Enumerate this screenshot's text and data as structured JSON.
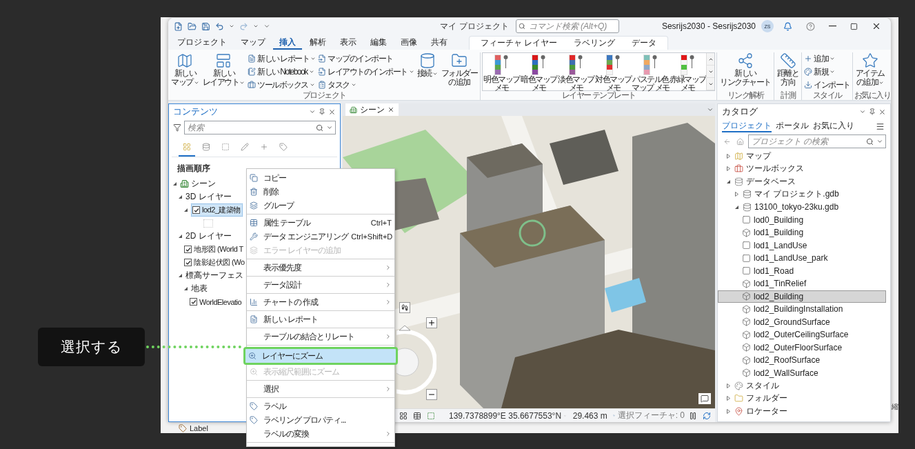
{
  "callout": {
    "text": "選択する"
  },
  "background_window": {
    "bottom_label": "Label",
    "edge_text": "縮"
  },
  "title_bar": {
    "project": "マイ プロジェクト",
    "search": {
      "placeholder": "コマンド検索 (Alt+Q)"
    },
    "user": "Sesrijs2030 - Sesrijs2030",
    "avatar": "ZS"
  },
  "ribbon_tabs": [
    {
      "label": "プロジェクト",
      "selected": false
    },
    {
      "label": "マップ",
      "selected": false
    },
    {
      "label": "挿入",
      "selected": true
    },
    {
      "label": "解析",
      "selected": false
    },
    {
      "label": "表示",
      "selected": false
    },
    {
      "label": "編集",
      "selected": false
    },
    {
      "label": "画像",
      "selected": false
    },
    {
      "label": "共有",
      "selected": false
    }
  ],
  "contextual_tabs": [
    {
      "label": "フィーチャ レイヤー"
    },
    {
      "label": "ラベリング"
    },
    {
      "label": "データ"
    }
  ],
  "ribbon_groups": [
    {
      "title": "プロジェクト",
      "controls": [
        {
          "kind": "large",
          "lines": [
            "新しい",
            "マップ"
          ],
          "dropdown": true
        },
        {
          "kind": "large",
          "lines": [
            "新しい",
            "レイアウト"
          ],
          "dropdown": true
        },
        {
          "kind": "stack",
          "items": [
            {
              "label": "新しい レポート",
              "dropdown": true
            },
            {
              "label": "新しい Notebook",
              "dropdown": true
            },
            {
              "label": "ツールボックス",
              "dropdown": true
            }
          ]
        },
        {
          "kind": "stack",
          "items": [
            {
              "label": "マップのインポート",
              "dropdown": false
            },
            {
              "label": "レイアウトのインポート",
              "dropdown": true
            },
            {
              "label": "タスク",
              "dropdown": true
            }
          ]
        },
        {
          "kind": "large",
          "lines": [
            "接続"
          ],
          "dropdown": true
        },
        {
          "kind": "large",
          "lines": [
            "フォルダー",
            "の追加"
          ],
          "dropdown": false
        }
      ]
    },
    {
      "title": "レイヤー テンプレート",
      "controls": [
        {
          "kind": "gallery",
          "items": [
            {
              "lines": [
                "明色マップ",
                "メモ"
              ],
              "swatch": [
                {
                  "color": "#e06060"
                },
                {
                  "color": "#3c9ad6"
                },
                {
                  "color": "#5aa84a"
                },
                {
                  "color": "#9a6cb0"
                }
              ]
            },
            {
              "lines": [
                "暗色マップ",
                "メモ"
              ],
              "swatch": [
                {
                  "color": "#d81818"
                },
                {
                  "color": "#2e6fc0"
                },
                {
                  "color": "#3a8a2a"
                },
                {
                  "color": "#8a4aa0"
                }
              ]
            },
            {
              "lines": [
                "淡色マップ",
                "メモ"
              ],
              "swatch": [
                {
                  "color": "#e02828"
                },
                {
                  "color": "#3d6fb0"
                },
                {
                  "color": "#4a9a3a"
                },
                {
                  "color": "#9a5a9a"
                }
              ]
            },
            {
              "lines": [
                "対色マップ",
                "メモ"
              ],
              "swatch": [
                {
                  "color": "#3c78c0"
                },
                {
                  "color": "#6aa84f"
                },
                {
                  "color": "#e03030"
                },
                {
                  "color": "#f4f4f4"
                }
              ]
            },
            {
              "lines": [
                "パステル色",
                "マップ メモ"
              ],
              "swatch": [
                {
                  "color": "#7fc0b8"
                },
                {
                  "color": "#f0a860"
                },
                {
                  "color": "#8fa8c8"
                },
                {
                  "color": "#e89ab0"
                }
              ]
            },
            {
              "lines": [
                "赤緑マップ",
                "メモ"
              ],
              "swatch": [
                {
                  "color": "#e01818"
                },
                {
                  "color": "#f4f4f4"
                },
                {
                  "color": "#50c040"
                },
                {
                  "color": "#f4f4f4"
                }
              ]
            }
          ]
        }
      ]
    },
    {
      "title": "リンク解析",
      "controls": [
        {
          "kind": "large",
          "lines": [
            "新しい",
            "リンクチャート"
          ],
          "dropdown": false
        }
      ]
    },
    {
      "title": "計測",
      "controls": [
        {
          "kind": "large",
          "lines": [
            "距離と",
            "方向"
          ],
          "dropdown": false
        }
      ]
    },
    {
      "title": "スタイル",
      "controls": [
        {
          "kind": "stack",
          "items": [
            {
              "label": "追加",
              "dropdown": true
            },
            {
              "label": "新規",
              "dropdown": true
            },
            {
              "label": "インポート",
              "dropdown": false
            }
          ]
        }
      ]
    },
    {
      "title": "お気に入り",
      "controls": [
        {
          "kind": "large",
          "lines": [
            "アイテム",
            "の追加"
          ],
          "dropdown": true
        }
      ]
    }
  ],
  "contents": {
    "title": "コンテンツ",
    "search": {
      "placeholder": "検索"
    },
    "views": [
      {
        "selected": true
      },
      {
        "selected": false
      },
      {
        "selected": false
      },
      {
        "selected": false
      },
      {
        "selected": false
      },
      {
        "selected": false
      }
    ],
    "heading": "描画順序",
    "tree": [
      {
        "kind": "scene",
        "label": "シーン",
        "expanded": true,
        "children": [
          {
            "kind": "group",
            "label": "3D レイヤー",
            "expanded": true,
            "children": [
              {
                "kind": "layer",
                "label": "lod2_建築物",
                "checked": true,
                "selected": true,
                "expanded": true
              }
            ]
          },
          {
            "kind": "group",
            "label": "2D レイヤー",
            "expanded": true,
            "children": [
              {
                "kind": "layer",
                "label": "地形図 (World T",
                "checked": true,
                "selected": false
              },
              {
                "kind": "layer",
                "label": "陰影起伏図 (Wo",
                "checked": true,
                "selected": false
              }
            ]
          },
          {
            "kind": "group",
            "label": "標高サーフェス",
            "expanded": true,
            "children": [
              {
                "kind": "group",
                "label": "地表",
                "expanded": true,
                "children": [
                  {
                    "kind": "layer",
                    "label": "WorldElevatio",
                    "checked": true,
                    "selected": false
                  }
                ]
              }
            ]
          }
        ]
      }
    ]
  },
  "scene": {
    "tab": "シーン",
    "coordinates": "139.7378899°E 35.6677553°N",
    "elevation": "29.463 m",
    "selected_features": "選択フィーチャ: 0"
  },
  "catalog": {
    "title": "カタログ",
    "tabs": [
      {
        "label": "プロジェクト",
        "selected": true
      },
      {
        "label": "ポータル",
        "selected": false
      },
      {
        "label": "お気に入り",
        "selected": false
      }
    ],
    "search": {
      "placeholder": "プロジェクト の検索"
    },
    "tree": [
      {
        "kind": "maps",
        "label": "マップ",
        "expanded": false
      },
      {
        "kind": "toolboxes",
        "label": "ツールボックス",
        "expanded": false
      },
      {
        "kind": "databases",
        "label": "データベース",
        "expanded": true,
        "children": [
          {
            "kind": "gdb",
            "label": "マイ プロジェクト.gdb",
            "expanded": false
          },
          {
            "kind": "gdb",
            "label": "13100_tokyo-23ku.gdb",
            "expanded": true,
            "children": [
              {
                "kind": "polygon",
                "label": "lod0_Building",
                "selected": false
              },
              {
                "kind": "multipatch",
                "label": "lod1_Building",
                "selected": false
              },
              {
                "kind": "polygon",
                "label": "lod1_LandUse",
                "selected": false
              },
              {
                "kind": "polygon",
                "label": "lod1_LandUse_park",
                "selected": false
              },
              {
                "kind": "polygon",
                "label": "lod1_Road",
                "selected": false
              },
              {
                "kind": "multipatch",
                "label": "lod1_TinRelief",
                "selected": false
              },
              {
                "kind": "multipatch",
                "label": "lod2_Building",
                "selected": true
              },
              {
                "kind": "multipatch",
                "label": "lod2_BuildingInstallation",
                "selected": false
              },
              {
                "kind": "multipatch",
                "label": "lod2_GroundSurface",
                "selected": false
              },
              {
                "kind": "multipatch",
                "label": "lod2_OuterCeilingSurface",
                "selected": false
              },
              {
                "kind": "multipatch",
                "label": "lod2_OuterFloorSurface",
                "selected": false
              },
              {
                "kind": "multipatch",
                "label": "lod2_RoofSurface",
                "selected": false
              },
              {
                "kind": "multipatch",
                "label": "lod2_WallSurface",
                "selected": false
              }
            ]
          }
        ]
      },
      {
        "kind": "styles",
        "label": "スタイル",
        "expanded": false
      },
      {
        "kind": "folders",
        "label": "フォルダー",
        "expanded": false
      },
      {
        "kind": "locators",
        "label": "ロケーター",
        "expanded": false
      }
    ]
  },
  "context_menu": {
    "sections": [
      [
        {
          "label": "コピー",
          "disabled": false,
          "selected": false
        },
        {
          "label": "削除",
          "disabled": false,
          "selected": false
        },
        {
          "label": "グループ",
          "disabled": false,
          "selected": false
        }
      ],
      [
        {
          "label": "属性 テーブル",
          "shortcut": "Ctrl+T",
          "disabled": false,
          "selected": false
        },
        {
          "label": "データ エンジニアリング",
          "shortcut": "Ctrl+Shift+D",
          "disabled": false,
          "selected": false
        },
        {
          "label": "エラー レイヤーの追加",
          "disabled": true,
          "selected": false
        }
      ],
      [
        {
          "label": "表示優先度",
          "submenu": true,
          "disabled": false,
          "selected": false
        }
      ],
      [
        {
          "label": "データ設計",
          "submenu": true,
          "disabled": false,
          "selected": false
        }
      ],
      [
        {
          "label": "チャートの 作成",
          "submenu": true,
          "disabled": false,
          "selected": false
        }
      ],
      [
        {
          "label": "新しい レポート",
          "disabled": false,
          "selected": false
        }
      ],
      [
        {
          "label": "テーブルの結合とリレート",
          "submenu": true,
          "disabled": false,
          "selected": false
        }
      ],
      [
        {
          "label": "レイヤーにズーム",
          "disabled": false,
          "selected": true
        },
        {
          "label": "表示縮尺範囲にズーム",
          "disabled": true,
          "selected": false
        }
      ],
      [
        {
          "label": "選択",
          "submenu": true,
          "disabled": false,
          "selected": false
        }
      ],
      [
        {
          "label": "ラベル",
          "disabled": false,
          "selected": false
        },
        {
          "label": "ラベリング プロパティ...",
          "disabled": false,
          "selected": false
        },
        {
          "label": "ラベルの変換",
          "submenu": true,
          "disabled": false,
          "selected": false
        }
      ]
    ]
  }
}
